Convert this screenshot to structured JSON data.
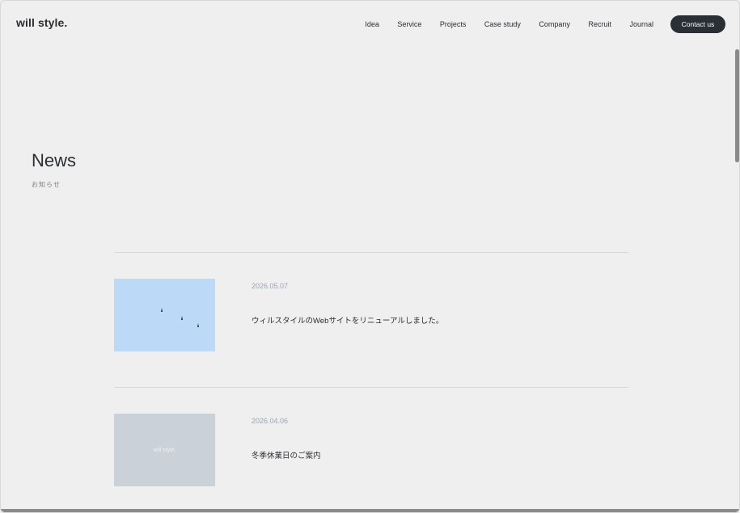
{
  "header": {
    "logo": "will style.",
    "nav": [
      "Idea",
      "Service",
      "Projects",
      "Case study",
      "Company",
      "Recruit",
      "Journal"
    ],
    "contact_label": "Contact us"
  },
  "page": {
    "title": "News",
    "subtitle": "お知らせ"
  },
  "news": [
    {
      "date": "2026.05.07",
      "text": "ウィルスタイルのWebサイトをリニューアルしました。",
      "thumb": "sky-birds"
    },
    {
      "date": "2026.04.06",
      "text": "冬季休業日のご案内",
      "thumb": "logo-placeholder",
      "thumb_label": "will style."
    }
  ],
  "colors": {
    "background": "#efefef",
    "text": "#2a2d31",
    "date": "#9aa4b4",
    "button": "#2a2f35",
    "thumb_sky": "#bcd9f8",
    "thumb_grey": "#cbd1d9"
  }
}
